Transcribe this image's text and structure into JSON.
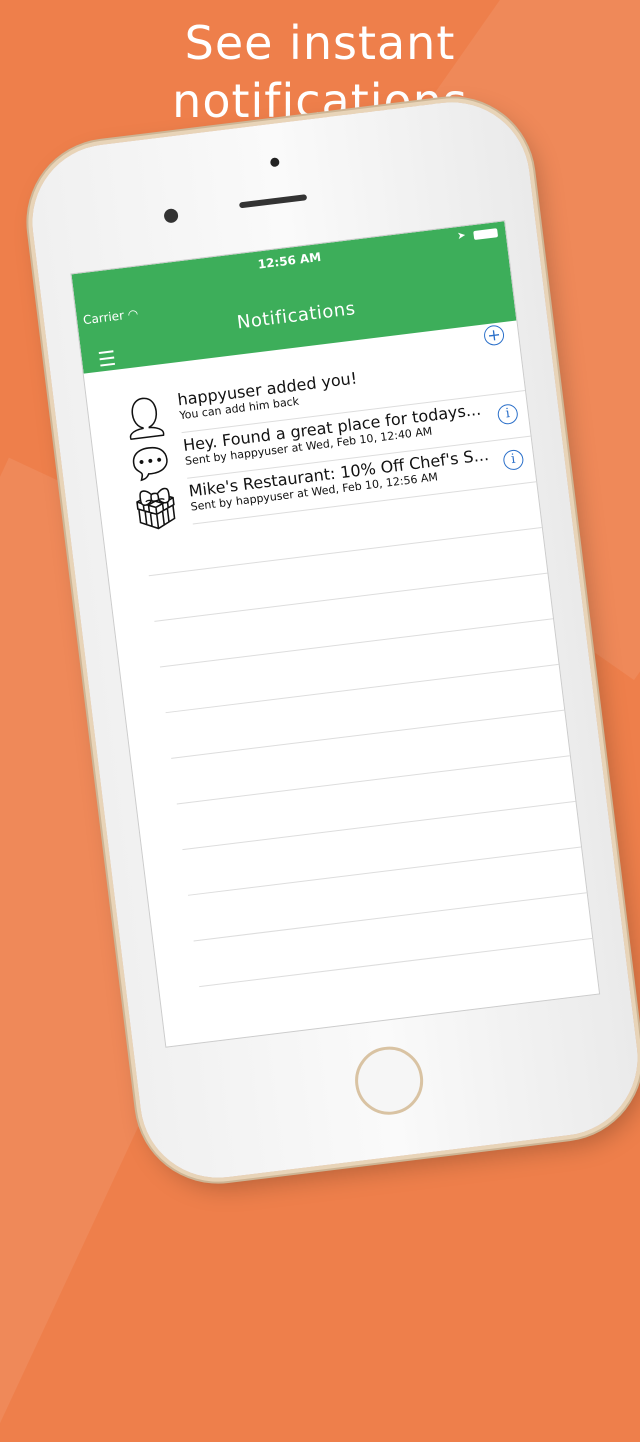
{
  "headline": [
    "See instant",
    "notifications"
  ],
  "colors": {
    "background": "#ee7f4b",
    "header": "#3dae5a",
    "accent": "#2a6fc9"
  },
  "status_bar": {
    "carrier": "Carrier",
    "time": "12:56 AM"
  },
  "nav": {
    "title": "Notifications",
    "menu_icon": "hamburger-icon",
    "add_icon": "plus-circle-icon"
  },
  "notifications": [
    {
      "icon": "add-user-icon",
      "title": "happyuser added you!",
      "subtitle": "You can add him back"
    },
    {
      "icon": "speech-bubble-icon",
      "title": "Hey. Found a great place for todays...",
      "subtitle": "Sent by happyuser at Wed, Feb 10, 12:40 AM"
    },
    {
      "icon": "gift-icon",
      "title": "Mike's Restaurant: 10% Off Chef's S...",
      "subtitle": "Sent by happyuser at Wed, Feb 10, 12:56 AM"
    }
  ]
}
